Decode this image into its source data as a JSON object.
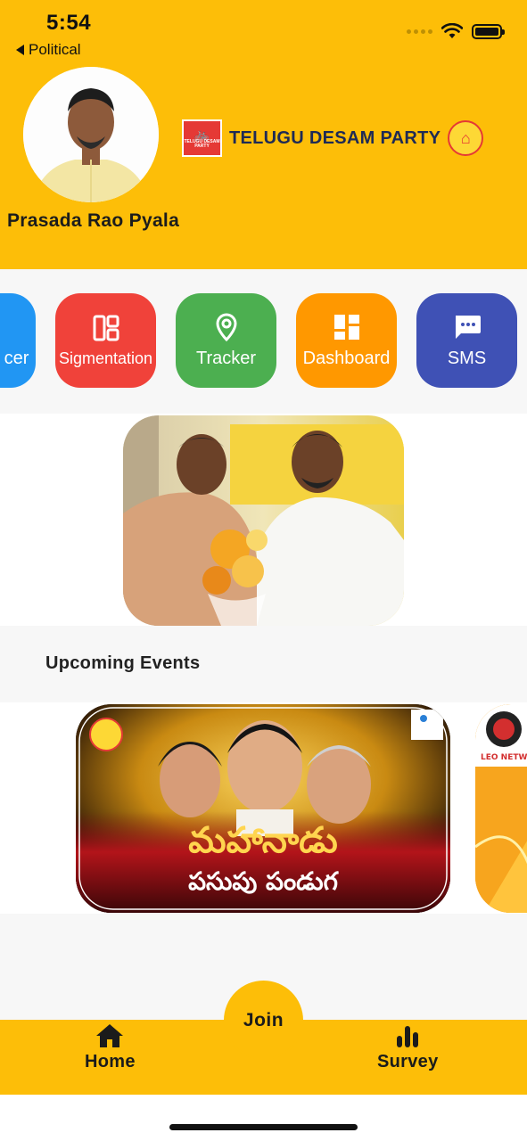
{
  "status_bar": {
    "time": "5:54",
    "back_label": "Political"
  },
  "profile": {
    "name": "Prasada Rao Pyala"
  },
  "party": {
    "name": "TELUGU DESAM PARTY",
    "badge_text": "TELUGU DESAM PARTY"
  },
  "actions": [
    {
      "label": "cer",
      "color": "#2196f3",
      "icon": "info-icon"
    },
    {
      "label": "Sigmentation",
      "color": "#f0423a",
      "icon": "grid-layout-icon"
    },
    {
      "label": "Tracker",
      "color": "#4caf50",
      "icon": "location-pin-icon"
    },
    {
      "label": "Dashboard",
      "color": "#ff9800",
      "icon": "dashboard-icon"
    },
    {
      "label": "SMS",
      "color": "#3f51b5",
      "icon": "message-icon"
    }
  ],
  "events": {
    "title": "Upcoming Events",
    "cards": [
      {
        "title_te": "మహానాడు",
        "subtitle_te": "పసుపు పండుగ"
      },
      {
        "brand": "LEO NETWORK"
      }
    ]
  },
  "nav": {
    "home_label": "Home",
    "join_label": "Join",
    "survey_label": "Survey"
  },
  "colors": {
    "brand_yellow": "#fdbe08"
  }
}
